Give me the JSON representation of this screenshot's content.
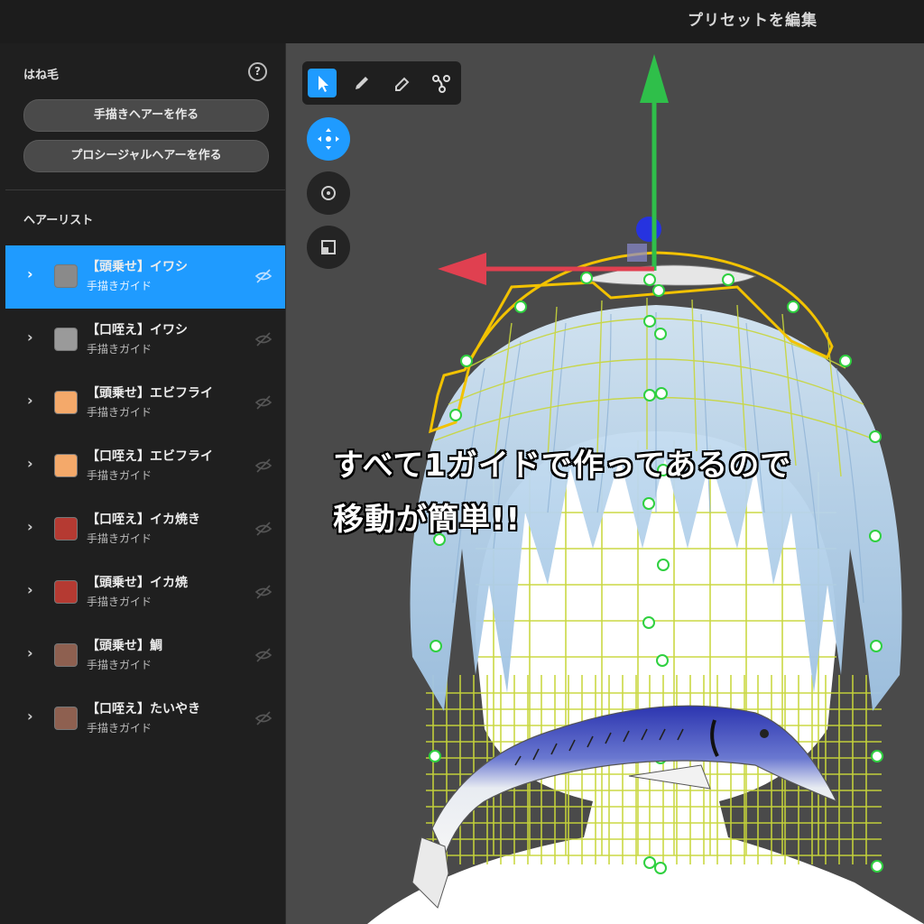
{
  "topbar": {
    "title": "プリセットを編集"
  },
  "sidebar": {
    "section_title": "はね毛",
    "help_label": "?",
    "buttons": [
      "手描きヘアーを作る",
      "プロシージャルヘアーを作る"
    ],
    "list_title": "ヘアーリスト",
    "items": [
      {
        "name": "【頭乗せ】イワシ",
        "sub": "手描きガイド",
        "color": "#8a8a8a",
        "selected": true
      },
      {
        "name": "【口咥え】イワシ",
        "sub": "手描きガイド",
        "color": "#9a9a9a",
        "selected": false
      },
      {
        "name": "【頭乗せ】エビフライ",
        "sub": "手描きガイド",
        "color": "#f4a96a",
        "selected": false
      },
      {
        "name": "【口咥え】エビフライ",
        "sub": "手描きガイド",
        "color": "#f4a96a",
        "selected": false
      },
      {
        "name": "【口咥え】イカ焼き",
        "sub": "手描きガイド",
        "color": "#b53a32",
        "selected": false
      },
      {
        "name": "【頭乗せ】イカ焼",
        "sub": "手描きガイド",
        "color": "#b53a32",
        "selected": false
      },
      {
        "name": "【頭乗せ】鯛",
        "sub": "手描きガイド",
        "color": "#8e6050",
        "selected": false
      },
      {
        "name": "【口咥え】たいやき",
        "sub": "手描きガイド",
        "color": "#8e6050",
        "selected": false
      }
    ]
  },
  "viewport": {
    "caption_line1": "すべて1ガイドで作ってあるので",
    "caption_line2": "移動が簡単!!"
  },
  "icons": {
    "tools": [
      "select-arrow-icon",
      "pencil-icon",
      "eraser-icon",
      "path-node-icon"
    ],
    "transforms": [
      "move-icon",
      "rotate-icon",
      "scale-icon"
    ],
    "item_visibility": "eye-off-icon",
    "item_expand": "chevron-right-icon"
  },
  "colors": {
    "accent": "#1f9bff",
    "gizmo_y": "#2fbf4a",
    "gizmo_x": "#e04050",
    "gizmo_z": "#3040e0",
    "guide": "#f2c200",
    "hair": "#bcd8ef",
    "mesh": "#c8d63a"
  }
}
